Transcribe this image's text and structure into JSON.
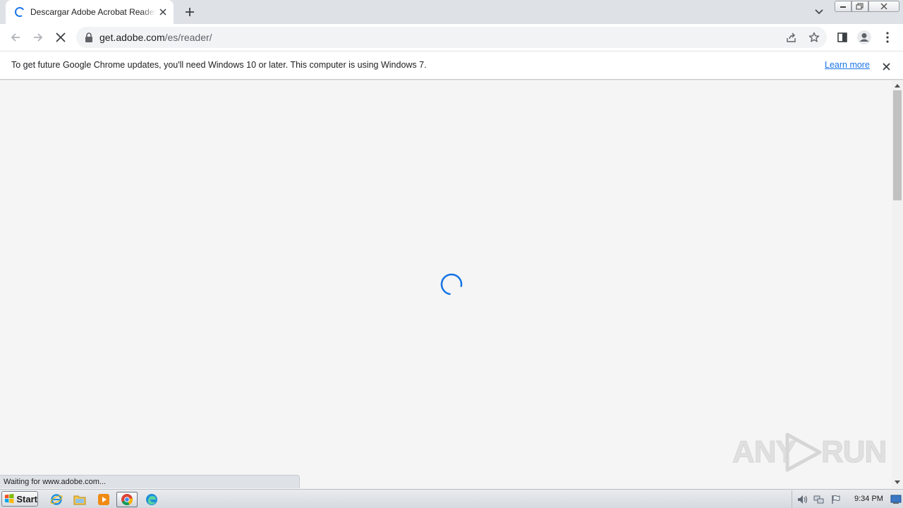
{
  "browser": {
    "tab": {
      "title": "Descargar Adobe Acrobat Reader: versión gratuita"
    },
    "url": {
      "host": "get.adobe.com",
      "path": "/es/reader/"
    },
    "infobar": {
      "message": "To get future Google Chrome updates, you'll need Windows 10 or later. This computer is using Windows 7.",
      "link": "Learn more"
    },
    "status": "Waiting for www.adobe.com...",
    "accent": "#1a73e8"
  },
  "watermark": {
    "left": "ANY",
    "right": "RUN"
  },
  "taskbar": {
    "start_label": "Start",
    "pinned": [
      "ie-icon",
      "explorer-icon",
      "media-player-icon",
      "chrome-icon",
      "edge-icon"
    ],
    "clock": "9:34 PM"
  }
}
